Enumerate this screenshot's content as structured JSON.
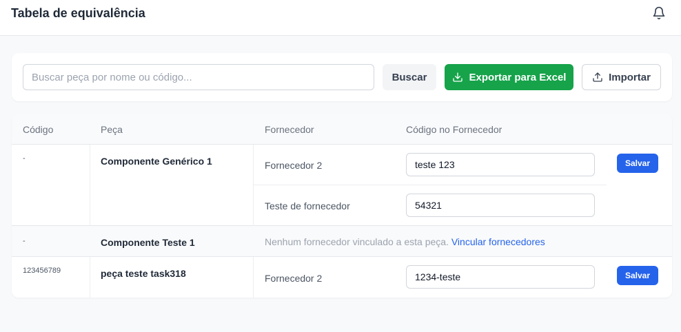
{
  "header": {
    "title": "Tabela de equivalência",
    "bell_icon": "bell-icon"
  },
  "toolbar": {
    "search_placeholder": "Buscar peça por nome ou código...",
    "search_value": "",
    "search_label": "Buscar",
    "export_label": "Exportar para Excel",
    "import_label": "Importar"
  },
  "colors": {
    "export_bg": "#16a34a",
    "save_bg": "#2563eb",
    "link": "#2563eb"
  },
  "table": {
    "headers": [
      "Código",
      "Peça",
      "Fornecedor",
      "Código no Fornecedor"
    ],
    "rows": [
      {
        "code": "-",
        "part": "Componente Genérico 1",
        "suppliers": [
          {
            "name": "Fornecedor 2",
            "code": "teste 123"
          },
          {
            "name": "Teste de fornecedor",
            "code": "54321"
          }
        ],
        "save_label": "Salvar"
      },
      {
        "code": "-",
        "part": "Componente Teste 1",
        "empty_message": "Nenhum fornecedor vinculado a esta peça.",
        "link_label": "Vincular fornecedores"
      },
      {
        "code": "123456789",
        "part": "peça teste task318",
        "suppliers": [
          {
            "name": "Fornecedor 2",
            "code": "1234-teste"
          }
        ],
        "save_label": "Salvar"
      }
    ]
  }
}
